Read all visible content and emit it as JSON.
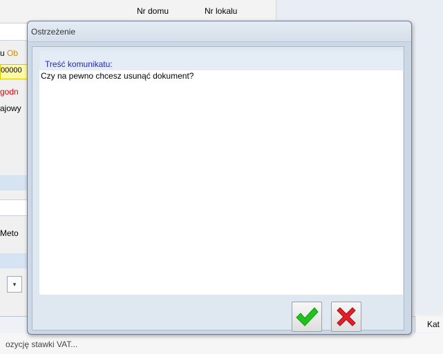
{
  "background": {
    "column_headers": [
      "Nr domu",
      "Nr lokalu"
    ],
    "left_fragments": [
      "u",
      "Ob",
      "00000",
      "godn",
      "ajowy",
      "Meto"
    ],
    "dropdown_symbol": "▾",
    "bottom_column": "Kat",
    "status_text": "ozycję stawki VAT..."
  },
  "dialog": {
    "title": "Ostrzeżenie",
    "label": "Treść komunikatu:",
    "message": "Czy na pewno chcesz usunąć dokument?",
    "buttons": {
      "ok_icon": "check-icon",
      "cancel_icon": "cross-icon"
    }
  },
  "colors": {
    "label": "#1f1fcf",
    "ok": "#21c21f",
    "cancel": "#e1202a",
    "warning_red": "#e00000",
    "warning_orange": "#d08a00"
  }
}
